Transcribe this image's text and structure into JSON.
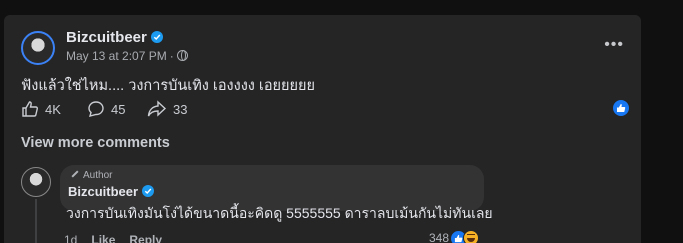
{
  "post": {
    "author": "Bizcuitbeer",
    "date": "May 13 at 2:07 PM",
    "dot": "·",
    "text": "ฟังแล้วใช่ไหม.... วงการบันเทิง เองงงง เอยยยยย",
    "likes": "4K",
    "comments": "45",
    "shares": "33",
    "more": "•••",
    "icons": [
      "verified-badge-icon",
      "globe-icon",
      "more-icon",
      "thumbs-up-icon",
      "comment-icon",
      "share-icon",
      "like-reaction-icon"
    ]
  },
  "view_more": "View more comments",
  "comment": {
    "badge": "Author",
    "author": "Bizcuitbeer",
    "text": "วงการบันเทิงมันโง่ได้ขนาดนี้อะคิดดู 5555555 ดาราลบเม้นกันไม่ทันเลย",
    "time": "1d",
    "like": "Like",
    "reply": "Reply",
    "reaction_count": "348",
    "icons": [
      "like-reaction-icon",
      "haha-reaction-icon",
      "pencil-icon"
    ]
  },
  "colors": {
    "background": "#101010",
    "card": "#252526",
    "bubble": "#333334",
    "accent": "#1877f2"
  }
}
